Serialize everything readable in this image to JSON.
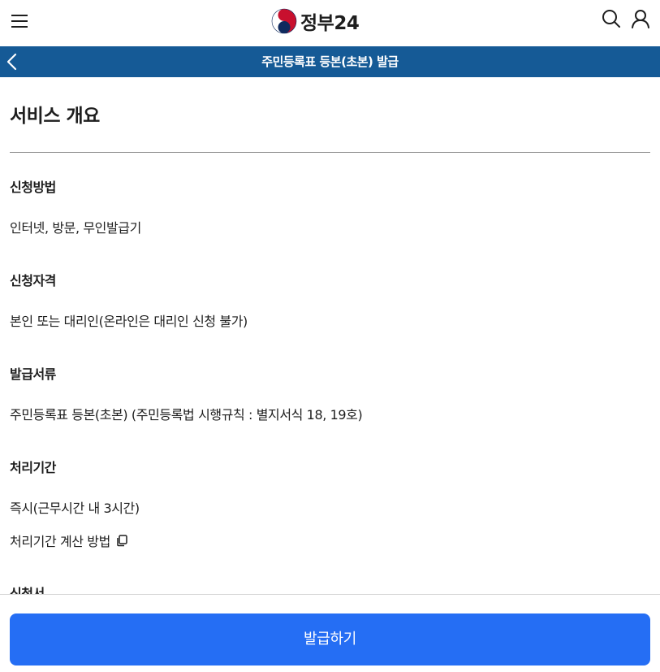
{
  "header": {
    "logo_text": "정부24",
    "menu_icon": "hamburger-menu-icon",
    "search_icon": "search-icon",
    "user_icon": "user-icon"
  },
  "titlebar": {
    "title": "주민등록표 등본(초본) 발급",
    "back_icon": "chevron-left-icon",
    "bg_color": "#155a96"
  },
  "overview": {
    "title": "서비스 개요",
    "sections": [
      {
        "label": "신청방법",
        "value": "인터넷, 방문, 무인발급기"
      },
      {
        "label": "신청자격",
        "value": "본인 또는 대리인(온라인은 대리인 신청 불가)"
      },
      {
        "label": "발급서류",
        "value": "주민등록표 등본(초본) (주민등록법 시행규칙 : 별지서식 18, 19호)"
      },
      {
        "label": "처리기간",
        "value": "즉시(근무시간 내 3시간)"
      },
      {
        "label": "신청서",
        "value": ""
      }
    ],
    "calc_link": "처리기간 계산 방법",
    "calc_link_icon": "copy-icon"
  },
  "bottom": {
    "issue_button": "발급하기",
    "button_color": "#256ef4"
  }
}
